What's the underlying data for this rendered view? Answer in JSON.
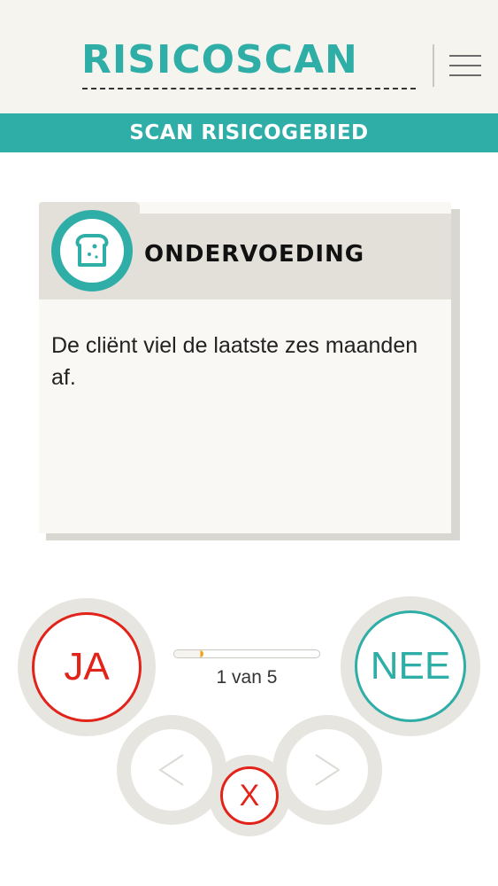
{
  "header": {
    "brand": "RISICOSCAN",
    "menu_icon": "hamburger-menu-icon"
  },
  "subheader": {
    "title": "SCAN RISICOGEBIED"
  },
  "card": {
    "icon": "bread-slice-icon",
    "title": "ONDERVOEDING",
    "statement": "De cliënt viel de laatste zes maanden af."
  },
  "controls": {
    "yes_label": "JA",
    "no_label": "NEE",
    "progress_label": "1 van 5",
    "progress_fraction": 0.2,
    "prev_label": "<",
    "next_label": ">",
    "close_label": "X"
  },
  "colors": {
    "accent": "#2eaea6",
    "yes": "#e2231a",
    "close": "#e2231a",
    "progress": "#f3a11a",
    "header_bg": "#f6f4ee"
  }
}
